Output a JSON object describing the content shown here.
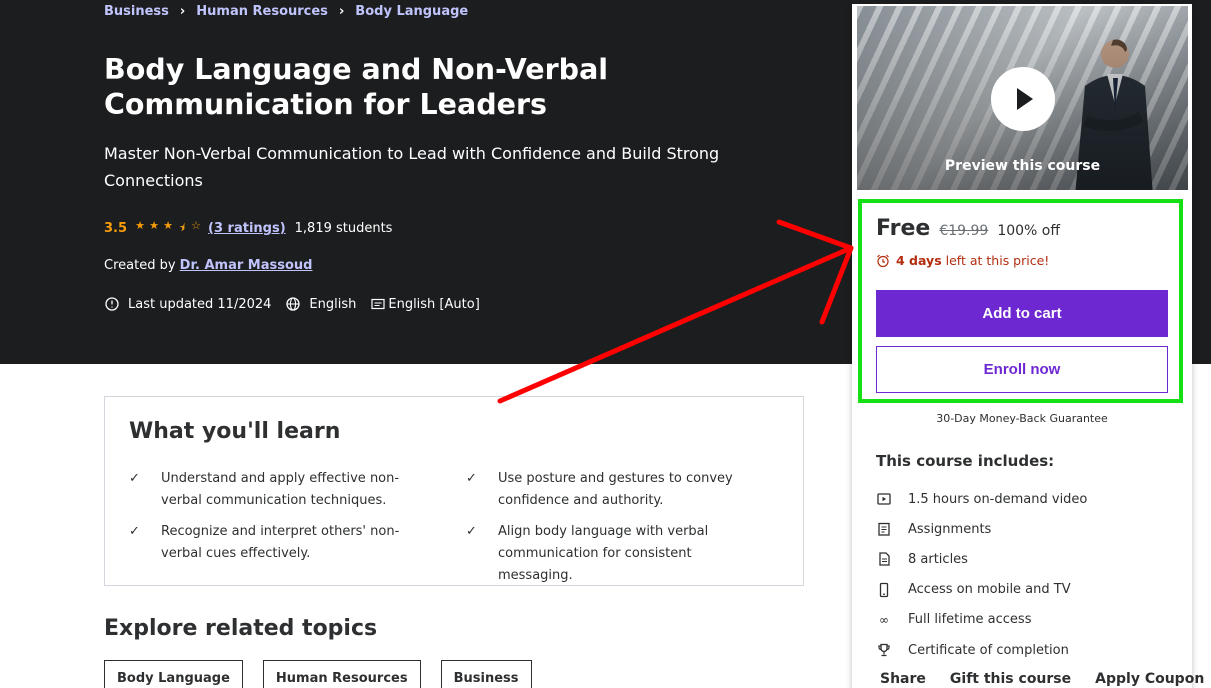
{
  "breadcrumb": [
    "Business",
    "Human Resources",
    "Body Language"
  ],
  "course": {
    "title": "Body Language and Non-Verbal Communication for Leaders",
    "subtitle": "Master Non-Verbal Communication to Lead with Confidence and Build Strong Connections",
    "rating": "3.5",
    "rating_value": 3.5,
    "rating_count": "(3 ratings)",
    "students": "1,819 students",
    "created_by_label": "Created by",
    "instructor": "Dr. Amar Massoud",
    "last_updated": "Last updated 11/2024",
    "language": "English",
    "captions": "English [Auto]"
  },
  "card": {
    "preview_label": "Preview this course",
    "price": "Free",
    "original_price": "€19.99",
    "discount": "100% off",
    "timer_bold": "4 days",
    "timer_rest": "left at this price!",
    "add_to_cart": "Add to cart",
    "enroll_now": "Enroll now",
    "guarantee": "30-Day Money-Back Guarantee",
    "includes_title": "This course includes:",
    "includes": [
      {
        "icon": "video-icon",
        "label": "1.5 hours on-demand video"
      },
      {
        "icon": "assignment-icon",
        "label": "Assignments"
      },
      {
        "icon": "article-icon",
        "label": "8 articles"
      },
      {
        "icon": "mobile-icon",
        "label": "Access on mobile and TV"
      },
      {
        "icon": "infinity-icon",
        "label": "Full lifetime access"
      },
      {
        "icon": "trophy-icon",
        "label": "Certificate of completion"
      }
    ],
    "share": "Share",
    "gift": "Gift this course",
    "coupon": "Apply Coupon"
  },
  "learn": {
    "title": "What you'll learn",
    "items": [
      "Understand and apply effective non-verbal communication techniques.",
      "Use posture and gestures to convey confidence and authority.",
      "Recognize and interpret others' non-verbal cues effectively.",
      "Align body language with verbal communication for consistent messaging."
    ]
  },
  "explore": {
    "title": "Explore related topics",
    "topics": [
      "Body Language",
      "Human Resources",
      "Business"
    ]
  },
  "colors": {
    "hero_bg": "#1c1d1f",
    "accent_purple": "#6d28d2",
    "link_lavender": "#c0c4fc",
    "star_orange": "#f69c08",
    "timer_red": "#b32d0f",
    "annotation_green": "#14e014",
    "annotation_red": "#ff0000"
  }
}
